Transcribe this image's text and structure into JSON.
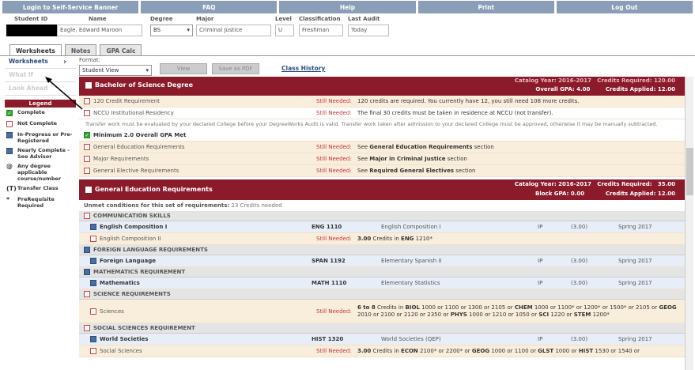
{
  "nav": [
    "Login to Self-Service Banner",
    "FAQ",
    "Help",
    "Print",
    "Log Out"
  ],
  "student": {
    "id_label": "Student ID",
    "name_label": "Name",
    "name": "Eagle, Edward Maroon",
    "degree_label": "Degree",
    "degree": "BS",
    "major_label": "Major",
    "major": "Criminal Justice",
    "level_label": "Level",
    "level": "U",
    "class_label": "Classification",
    "classification": "Freshman",
    "audit_label": "Last Audit",
    "last_audit": "Today"
  },
  "tabs": [
    "Worksheets",
    "Notes",
    "GPA Calc"
  ],
  "left_links": [
    "Worksheets",
    "What If",
    "Look Ahead"
  ],
  "legend": {
    "title": "Legend",
    "items": [
      {
        "sym": "check",
        "label": "Complete"
      },
      {
        "sym": "box",
        "label": "Not Complete"
      },
      {
        "sym": "blue",
        "label": "In-Progress or Pre-Registered"
      },
      {
        "sym": "blue",
        "label": "Nearly Complete - See Advisor"
      },
      {
        "sym": "@",
        "label": "Any degree applicable course/number"
      },
      {
        "sym": "(T)",
        "label": "Transfer Class"
      },
      {
        "sym": "*",
        "label": "PreRequisite Required"
      }
    ]
  },
  "format": {
    "label": "Format:",
    "value": "Student View",
    "view": "View",
    "pdf": "Save as PDF",
    "history": "Class History"
  },
  "degree_block": {
    "title": "Bachelor of Science Degree",
    "catalog_label": "Catalog Year:",
    "catalog": "2016-2017",
    "cred_req_label": "Credits Required:",
    "cred_req": "120.00",
    "gpa_label": "Overall GPA:",
    "gpa": "4.00",
    "applied_label": "Credits Applied:",
    "applied": "12.00",
    "rows": [
      {
        "label": "120 Credit Requirement",
        "status": "Still Needed:",
        "desc": "120 credits are required. You currently have 12, you still need 108 more credits.",
        "bg": "p"
      },
      {
        "label": "NCCU Institutional Residency",
        "status": "Still Needed:",
        "desc": "The final 30 credits must be taken in residence at NCCU (not transfer).",
        "bg": "w"
      },
      {
        "label": "Minimum 2.0 Overall GPA Met",
        "status": "",
        "desc": "",
        "bg": "w",
        "check": true
      },
      {
        "label": "General Education Requirements",
        "status": "Still Needed:",
        "desc_pre": "See ",
        "desc_bold": "General Education Requirements",
        "desc_post": " section",
        "bg": "p"
      },
      {
        "label": "Major Requirements",
        "status": "Still Needed:",
        "desc_pre": "See ",
        "desc_bold": "Major in Criminal Justice",
        "desc_post": " section",
        "bg": "p"
      },
      {
        "label": "General Elective Requirements",
        "status": "Still Needed:",
        "desc_pre": "See ",
        "desc_bold": "Required General Electives",
        "desc_post": " section",
        "bg": "p"
      }
    ],
    "note": "Transfer work must be evaluated by your declared College before your DegreeWorks Audit is valid. Transfer work taken after admission to your declared College must be approved, otherwise it may be manually subtracted."
  },
  "gened_block": {
    "title": "General Education Requirements",
    "catalog_label": "Catalog Year:",
    "catalog": "2016-2017",
    "cred_req_label": "Credits Required:",
    "cred_req": "35.00",
    "gpa_label": "Block GPA:",
    "gpa": "0.00",
    "applied_label": "Credits Applied:",
    "applied": "12.00",
    "unmet": "Unmet conditions for this set of requirements:",
    "unmet_val": "23 Credits needed",
    "cats": [
      {
        "name": "COMMUNICATION SKILLS",
        "icon": "box",
        "rows": [
          {
            "label": "English Composition I",
            "icon": "blue",
            "course": "ENG 1110",
            "title": "English Composition I",
            "grade": "IP",
            "credits": "(3.00)",
            "term": "Spring 2017"
          },
          {
            "label": "English Composition II",
            "icon": "box",
            "status": "Still Needed:",
            "desc_bold": "3.00",
            "desc_rest": " Credits in ",
            "desc_bold2": "ENG",
            "desc_rest2": " 1210*"
          }
        ]
      },
      {
        "name": "FOREIGN LANGUAGE REQUIREMENTS",
        "icon": "blue",
        "rows": [
          {
            "label": "Foreign Language",
            "icon": "blue",
            "course": "SPAN 1192",
            "title": "Elementary Spanish II",
            "grade": "IP",
            "credits": "(3.00)",
            "term": "Spring 2017"
          }
        ]
      },
      {
        "name": "MATHEMATICS REQUIREMENT",
        "icon": "blue",
        "rows": [
          {
            "label": "Mathematics",
            "icon": "blue",
            "course": "MATH 1110",
            "title": "Elementary Statistics",
            "grade": "IP",
            "credits": "(3.00)",
            "term": "Spring 2017"
          }
        ]
      },
      {
        "name": "SCIENCE REQUIREMENTS",
        "icon": "box",
        "rows": [
          {
            "label": "Sciences",
            "icon": "box",
            "status": "Still Needed:",
            "desc_html": "<b>6 to 8</b> Credits in <b>BIOL</b> 1000 or 1100 or 1300 or 2105 or <b>CHEM</b> 1000 or 1100* or 1200* or 1500* or 2105 or <b>GEOG</b> 2010 or 2100 or 2120 or 2350 or <b>PHYS</b> 1000 or 1210 or 1050 or <b>SCI</b> 1220 or <b>STEM</b> 1200*"
          }
        ]
      },
      {
        "name": "SOCIAL SCIENCES REQUIREMENT",
        "icon": "box",
        "rows": [
          {
            "label": "World Societies",
            "icon": "blue",
            "course": "HIST 1320",
            "title": "World Societies (QEP)",
            "grade": "IP",
            "credits": "(3.00)",
            "term": "Spring 2017"
          },
          {
            "label": "Social Sciences",
            "icon": "box",
            "status": "Still Needed:",
            "desc_html": "<b>3.00</b> Credits in <b>ECON</b> 2100* or 2200* or <b>GEOG</b> 1000 or 1100 or <b>GLST</b> 1000 or <b>HIST</b> 1530 or 1540 or"
          }
        ]
      }
    ]
  }
}
